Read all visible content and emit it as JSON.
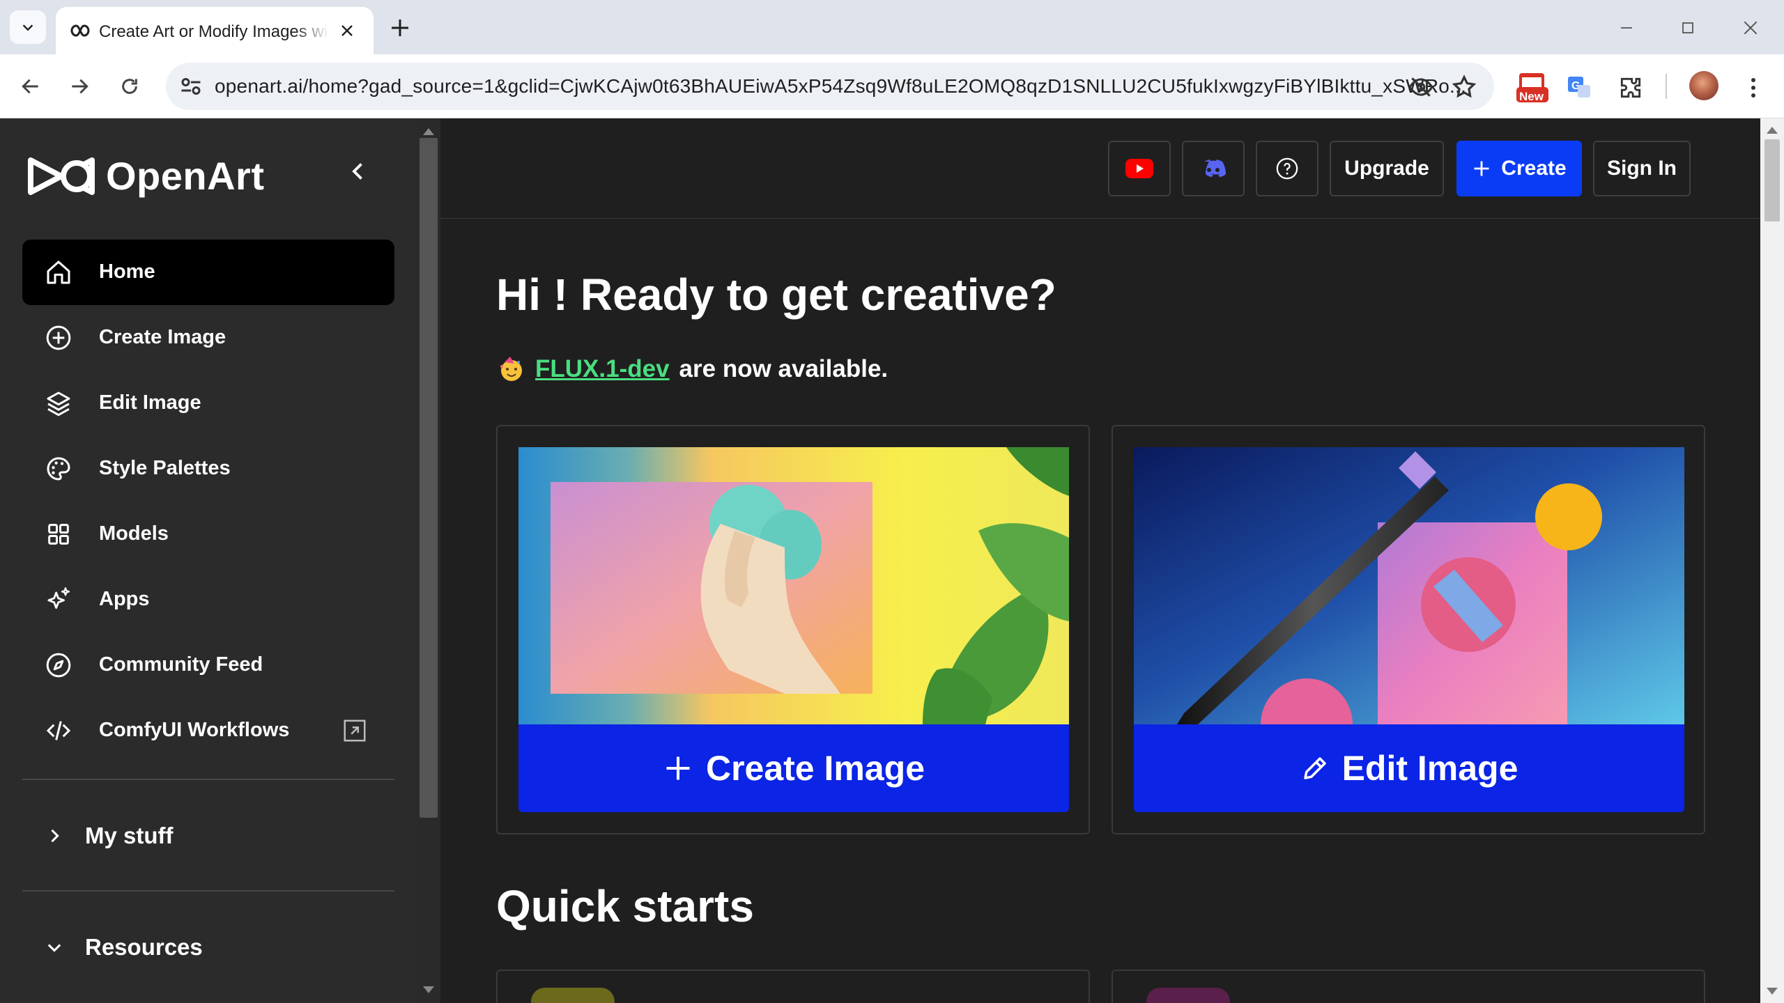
{
  "browser": {
    "tab_title": "Create Art or Modify Images with AI",
    "url": "openart.ai/home?gad_source=1&gclid=CjwKCAjw0t63BhAUEiwA5xP54Zsq9Wf8uLE2OMQ8qzD1SNLLU2CU5fukIxwgzyFiBYlBIkttu_xSWRo...",
    "new_badge": "New"
  },
  "sidebar": {
    "brand": "OpenArt",
    "items": [
      {
        "label": "Home",
        "icon": "home-icon"
      },
      {
        "label": "Create Image",
        "icon": "plus-circle-icon"
      },
      {
        "label": "Edit Image",
        "icon": "layers-icon"
      },
      {
        "label": "Style Palettes",
        "icon": "palette-icon"
      },
      {
        "label": "Models",
        "icon": "grid-icon"
      },
      {
        "label": "Apps",
        "icon": "sparkles-icon"
      },
      {
        "label": "Community Feed",
        "icon": "compass-icon"
      },
      {
        "label": "ComfyUI Workflows",
        "icon": "code-icon"
      }
    ],
    "my_stuff": "My stuff",
    "resources": "Resources"
  },
  "topbar": {
    "upgrade": "Upgrade",
    "create": "Create",
    "sign_in": "Sign In"
  },
  "main": {
    "greeting": "Hi ! Ready to get creative?",
    "announce_link": "FLUX.1-dev",
    "announce_rest": "are now available.",
    "card_create": "Create Image",
    "card_edit": "Edit Image",
    "quick_starts": "Quick starts"
  },
  "colors": {
    "accent_blue": "#0b3cf5",
    "cta_blue": "#0b24e5",
    "link_green": "#4ade80",
    "sidebar_bg": "#2b2b2b",
    "main_bg": "#1f1f1f"
  }
}
